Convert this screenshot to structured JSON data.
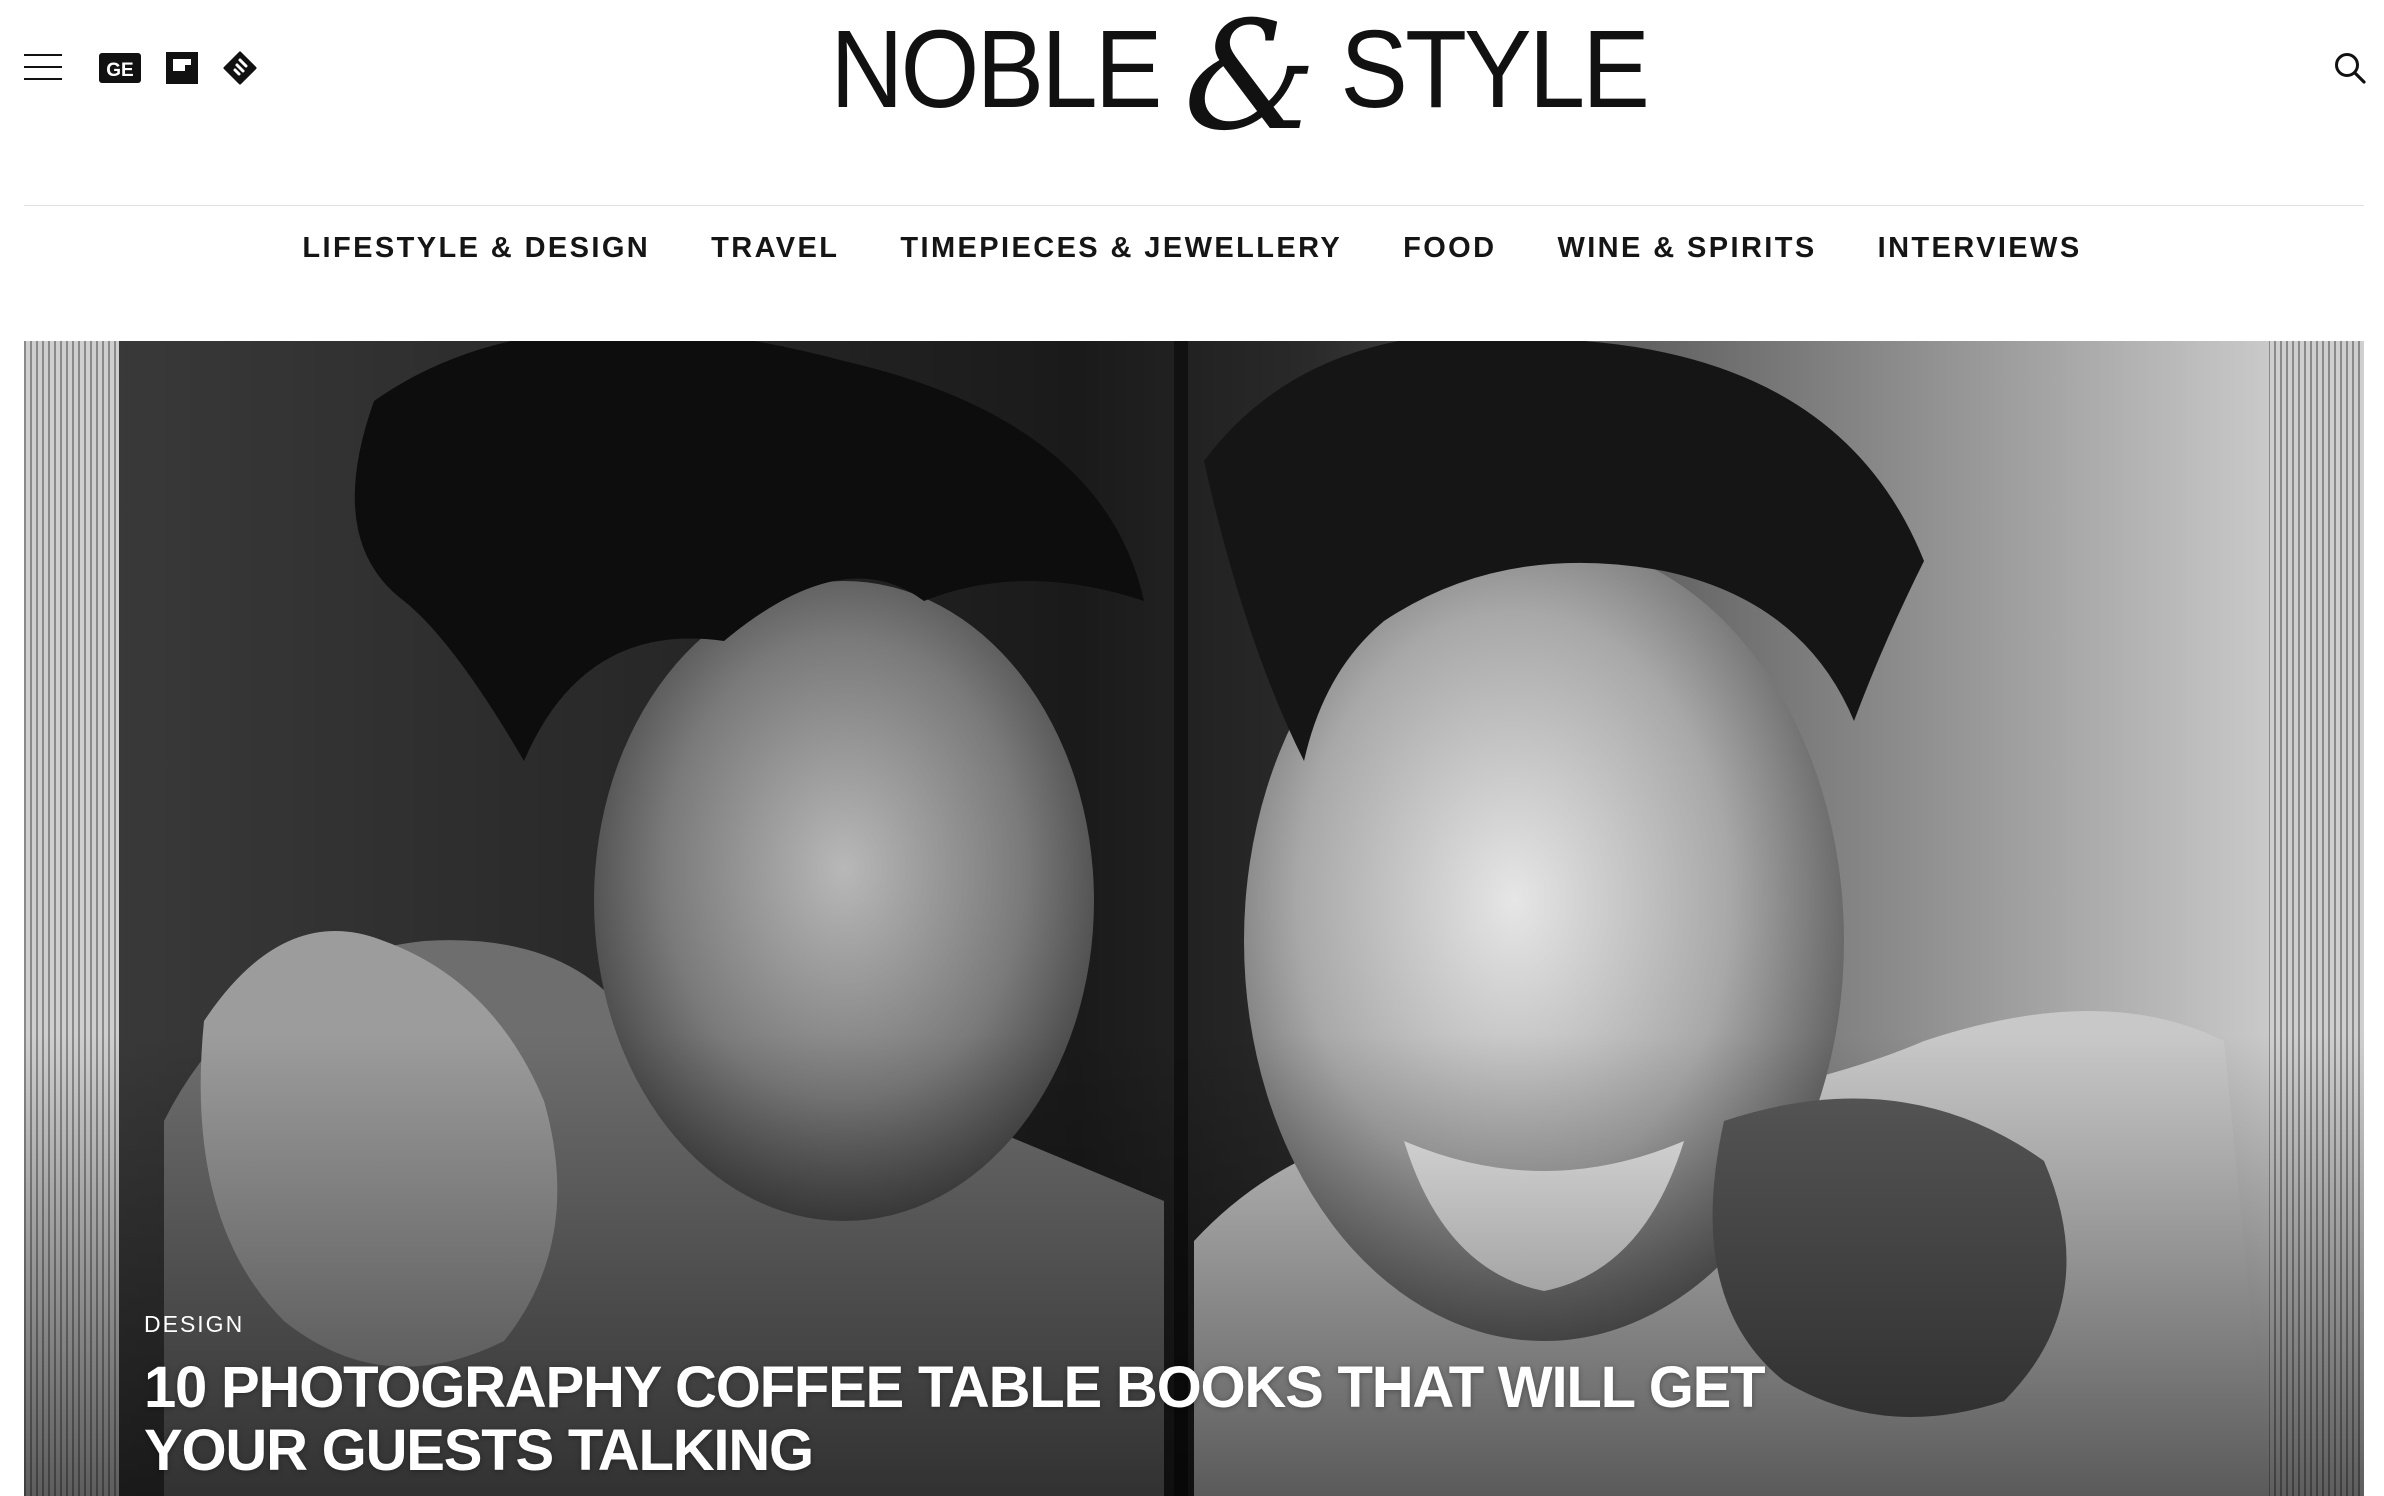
{
  "brand": {
    "logo_left": "NOBLE",
    "logo_amp": "&",
    "logo_right": "STYLE"
  },
  "header": {
    "menu_icon": "hamburger-icon",
    "social_icons": [
      "google-news-icon",
      "flipboard-icon",
      "feedly-icon"
    ],
    "google_news_glyph": "GE",
    "search_icon": "search-icon"
  },
  "nav": {
    "items": [
      {
        "label": "LIFESTYLE & DESIGN"
      },
      {
        "label": "TRAVEL"
      },
      {
        "label": "TIMEPIECES & JEWELLERY"
      },
      {
        "label": "FOOD"
      },
      {
        "label": "WINE & SPIRITS"
      },
      {
        "label": "INTERVIEWS"
      }
    ]
  },
  "hero": {
    "category": "DESIGN",
    "title_line1": "10 PHOTOGRAPHY COFFEE TABLE BOOKS THAT WILL GET",
    "title_line2": "YOUR GUESTS TALKING"
  },
  "colors": {
    "text": "#111111",
    "background": "#ffffff",
    "divider": "#e1e1e1",
    "hero_overlay_text": "#ffffff"
  }
}
